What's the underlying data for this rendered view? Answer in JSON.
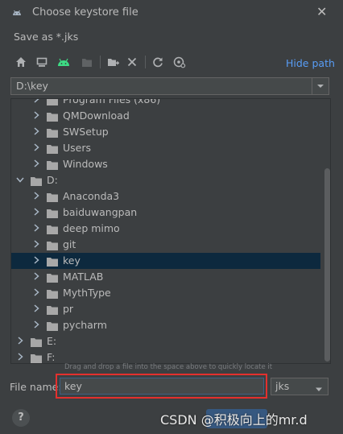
{
  "window": {
    "title": "Choose keystore file",
    "close_icon": "close-icon"
  },
  "dialog": {
    "subtitle": "Save as *.jks"
  },
  "toolbar": {
    "icons": [
      "home-icon",
      "desktop-icon",
      "android-icon",
      "new-folder-disabled-icon",
      "new-folder-icon",
      "delete-icon",
      "refresh-icon",
      "show-hidden-icon"
    ],
    "hide_path_label": "Hide path"
  },
  "path": {
    "value": "D:\\key"
  },
  "tree": {
    "rows": [
      {
        "label": "Program Files (x86)",
        "indent": 1,
        "expanded": false,
        "selected": false
      },
      {
        "label": "QMDownload",
        "indent": 1,
        "expanded": false,
        "selected": false
      },
      {
        "label": "SWSetup",
        "indent": 1,
        "expanded": false,
        "selected": false
      },
      {
        "label": "Users",
        "indent": 1,
        "expanded": false,
        "selected": false
      },
      {
        "label": "Windows",
        "indent": 1,
        "expanded": false,
        "selected": false
      },
      {
        "label": "D:",
        "indent": 0,
        "expanded": true,
        "selected": false
      },
      {
        "label": "Anaconda3",
        "indent": 1,
        "expanded": false,
        "selected": false
      },
      {
        "label": "baiduwangpan",
        "indent": 1,
        "expanded": false,
        "selected": false
      },
      {
        "label": "deep mimo",
        "indent": 1,
        "expanded": false,
        "selected": false
      },
      {
        "label": "git",
        "indent": 1,
        "expanded": false,
        "selected": false
      },
      {
        "label": "key",
        "indent": 1,
        "expanded": false,
        "selected": true
      },
      {
        "label": "MATLAB",
        "indent": 1,
        "expanded": false,
        "selected": false
      },
      {
        "label": "MythType",
        "indent": 1,
        "expanded": false,
        "selected": false
      },
      {
        "label": "pr",
        "indent": 1,
        "expanded": false,
        "selected": false
      },
      {
        "label": "pycharm",
        "indent": 1,
        "expanded": false,
        "selected": false
      },
      {
        "label": "E:",
        "indent": 0,
        "expanded": false,
        "selected": false
      },
      {
        "label": "F:",
        "indent": 0,
        "expanded": false,
        "selected": false
      }
    ],
    "hint": "Drag and drop a file into the space above to quickly locate it"
  },
  "file": {
    "label": "File name:",
    "value": "key",
    "extension": "jks"
  },
  "footer": {
    "help_label": "?",
    "watermark": "CSDN @积极向上的mr.d"
  },
  "colors": {
    "background": "#3c3f41",
    "selection": "#0d293e",
    "accent_link": "#589df6",
    "highlight_box": "#e3302e",
    "folder": "#a8a8a8",
    "android_green": "#3ddc84"
  }
}
